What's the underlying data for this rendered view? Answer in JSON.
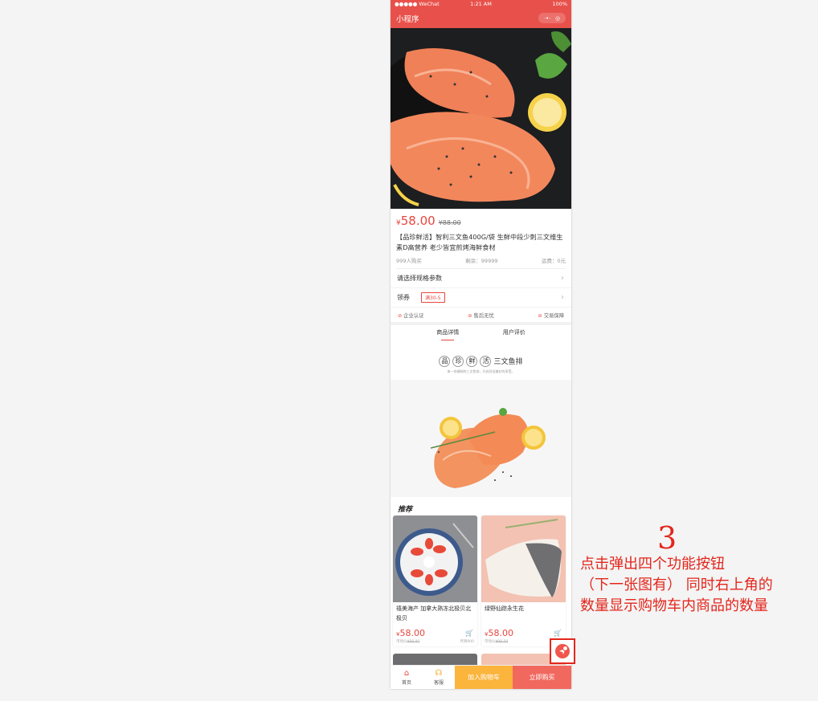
{
  "status": {
    "carrier": "●●●●● WeChat",
    "time": "1:21 AM",
    "battery": "100%"
  },
  "nav": {
    "title": "小程序",
    "more": "·•·",
    "close": "◎"
  },
  "product": {
    "currency": "¥",
    "price": "58.00",
    "old_price": "¥88.00",
    "title": "【品珍鲜活】智利三文鱼400G/袋 生鲜中段少刺三文维生素D高营养 老少皆宜煎烤海鲜食材",
    "sold": "999人购买",
    "stock": "剩余：99999",
    "shipping": "运费：0元"
  },
  "options": {
    "spec_label": "请选择规格参数",
    "coupon_label": "领券",
    "coupon_tag": "满30-5"
  },
  "guarantees": [
    "企业认证",
    "售后无忧",
    "交易保障"
  ],
  "tabs": [
    "商品详情",
    "用户评价"
  ],
  "brand": {
    "chars": [
      "品",
      "珍",
      "鲜",
      "活"
    ],
    "suffix": "三文鱼排",
    "sub": "来一份精制的三文鱼排，开启舒适美妙的享受。"
  },
  "recommend": {
    "title": "推荐",
    "items": [
      {
        "name": "禧美海产 加拿大熟冻北极贝北极贝",
        "price": "58.00",
        "old": "¥88.00",
        "old_prefix": "市场价",
        "sold": "月销900"
      },
      {
        "name": "绿野仙踪永生花",
        "price": "58.00",
        "old": "¥98.00",
        "old_prefix": "市场价",
        "sold": ""
      }
    ]
  },
  "tabbar": {
    "home": "首页",
    "service": "客服",
    "add_cart": "加入购物车",
    "buy_now": "立即购买"
  },
  "annotation": {
    "number": "3",
    "lines": [
      "点击弹出四个功能按钮",
      "（下一张图有） 同时右上角的",
      "数量显示购物车内商品的数量"
    ]
  },
  "colors": {
    "brand_red": "#e8514b",
    "price_red": "#e8463f",
    "cart_orange": "#fbb43c",
    "buy_red": "#f1685f",
    "annotation_red": "#e3261c"
  }
}
